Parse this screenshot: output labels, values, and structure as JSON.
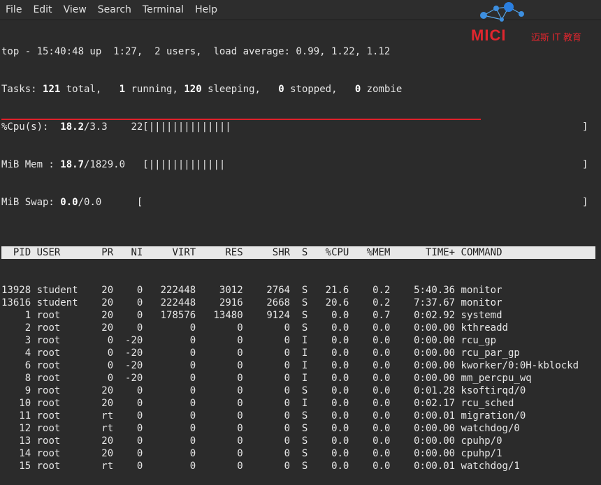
{
  "menu": [
    "File",
    "Edit",
    "View",
    "Search",
    "Terminal",
    "Help"
  ],
  "logo": {
    "brand": "MICI",
    "tagline": "迈斯 IT 教育"
  },
  "summary": {
    "top": "top - 15:40:48 up  1:27,  2 users,  load average: 0.99, 1.22, 1.12",
    "tasks_pre": "Tasks: ",
    "tasks_total": "121",
    "tasks_total_lbl": " total,   ",
    "tasks_running": "1",
    "tasks_running_lbl": " running, ",
    "tasks_sleeping": "120",
    "tasks_sleeping_lbl": " sleeping,   ",
    "tasks_stopped": "0",
    "tasks_stopped_lbl": " stopped,   ",
    "tasks_zombie": "0",
    "tasks_zombie_lbl": " zombie",
    "cpu_pre": "%Cpu(s):  ",
    "cpu_val": "18.2",
    "cpu_rest": "/3.3    22[||||||||||||||",
    "mem_pre": "MiB Mem : ",
    "mem_val": "18.7",
    "mem_rest": "/1829.0   [|||||||||||||",
    "swap_pre": "MiB Swap: ",
    "swap_val": "0.0",
    "swap_rest": "/0.0      [",
    "bracket": "]"
  },
  "columns": [
    "PID",
    "USER",
    "PR",
    "NI",
    "VIRT",
    "RES",
    "SHR",
    "S",
    "%CPU",
    "%MEM",
    "TIME+",
    "COMMAND"
  ],
  "rows": [
    [
      "13928",
      "student",
      "20",
      "0",
      "222448",
      "3012",
      "2764",
      "S",
      "21.6",
      "0.2",
      "5:40.36",
      "monitor"
    ],
    [
      "13616",
      "student",
      "20",
      "0",
      "222448",
      "2916",
      "2668",
      "S",
      "20.6",
      "0.2",
      "7:37.67",
      "monitor"
    ],
    [
      "1",
      "root",
      "20",
      "0",
      "178576",
      "13480",
      "9124",
      "S",
      "0.0",
      "0.7",
      "0:02.92",
      "systemd"
    ],
    [
      "2",
      "root",
      "20",
      "0",
      "0",
      "0",
      "0",
      "S",
      "0.0",
      "0.0",
      "0:00.00",
      "kthreadd"
    ],
    [
      "3",
      "root",
      "0",
      "-20",
      "0",
      "0",
      "0",
      "I",
      "0.0",
      "0.0",
      "0:00.00",
      "rcu_gp"
    ],
    [
      "4",
      "root",
      "0",
      "-20",
      "0",
      "0",
      "0",
      "I",
      "0.0",
      "0.0",
      "0:00.00",
      "rcu_par_gp"
    ],
    [
      "6",
      "root",
      "0",
      "-20",
      "0",
      "0",
      "0",
      "I",
      "0.0",
      "0.0",
      "0:00.00",
      "kworker/0:0H-kblockd"
    ],
    [
      "8",
      "root",
      "0",
      "-20",
      "0",
      "0",
      "0",
      "I",
      "0.0",
      "0.0",
      "0:00.00",
      "mm_percpu_wq"
    ],
    [
      "9",
      "root",
      "20",
      "0",
      "0",
      "0",
      "0",
      "S",
      "0.0",
      "0.0",
      "0:01.28",
      "ksoftirqd/0"
    ],
    [
      "10",
      "root",
      "20",
      "0",
      "0",
      "0",
      "0",
      "I",
      "0.0",
      "0.0",
      "0:02.17",
      "rcu_sched"
    ],
    [
      "11",
      "root",
      "rt",
      "0",
      "0",
      "0",
      "0",
      "S",
      "0.0",
      "0.0",
      "0:00.01",
      "migration/0"
    ],
    [
      "12",
      "root",
      "rt",
      "0",
      "0",
      "0",
      "0",
      "S",
      "0.0",
      "0.0",
      "0:00.00",
      "watchdog/0"
    ],
    [
      "13",
      "root",
      "20",
      "0",
      "0",
      "0",
      "0",
      "S",
      "0.0",
      "0.0",
      "0:00.00",
      "cpuhp/0"
    ],
    [
      "14",
      "root",
      "20",
      "0",
      "0",
      "0",
      "0",
      "S",
      "0.0",
      "0.0",
      "0:00.00",
      "cpuhp/1"
    ],
    [
      "15",
      "root",
      "rt",
      "0",
      "0",
      "0",
      "0",
      "S",
      "0.0",
      "0.0",
      "0:00.01",
      "watchdog/1"
    ]
  ],
  "colors": {
    "background": "#2b2b2b",
    "text": "#e6e6e6",
    "header_bg": "#e8e8e8",
    "accent_red": "#e0202a"
  }
}
